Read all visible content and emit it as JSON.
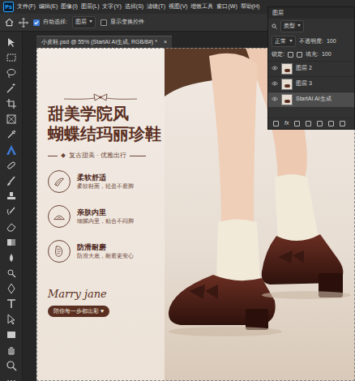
{
  "app": {
    "logo": "Ps"
  },
  "menu": [
    "文件(F)",
    "编辑(E)",
    "图像(I)",
    "图层(L)",
    "文字(Y)",
    "选择(S)",
    "滤镜(T)",
    "视图(V)",
    "增效工具",
    "窗口(W)",
    "帮助(H)"
  ],
  "options_bar": {
    "auto_select_label": "自动选择:",
    "auto_select_checked": true,
    "target": "图层",
    "show_transform_label": "显示变换控件",
    "show_transform_checked": false
  },
  "document_tab": {
    "title": "小皮鞋.psd @ 55% (StartAI AI生成, RGB/8#) *",
    "close": "×"
  },
  "layers_panel": {
    "title": "图层",
    "filter": "类型",
    "blend": "正常",
    "opacity_label": "不透明度:",
    "opacity": "100",
    "lock_label": "锁定:",
    "fill_label": "填充:",
    "fill": "100",
    "layers": [
      {
        "name": "图层 2",
        "selected": false
      },
      {
        "name": "图层 3",
        "selected": false
      },
      {
        "name": "StartAI AI生成",
        "selected": true
      }
    ],
    "footer": "fx"
  },
  "canvas": {
    "headline": [
      "甜美学院风",
      "蝴蝶结玛丽珍鞋"
    ],
    "tagline": "复古甜美 · 优雅出行",
    "features": [
      {
        "title": "柔软舒适",
        "desc": "柔软鞋面，轻盈不磨脚"
      },
      {
        "title": "亲肤内里",
        "desc": "细腻内里，贴合不闷脚"
      },
      {
        "title": "防滑耐磨",
        "desc": "防滑大底，耐磨更安心"
      }
    ],
    "signature": "Marry jane",
    "cta": "陪你每一步都出彩 ♥"
  }
}
